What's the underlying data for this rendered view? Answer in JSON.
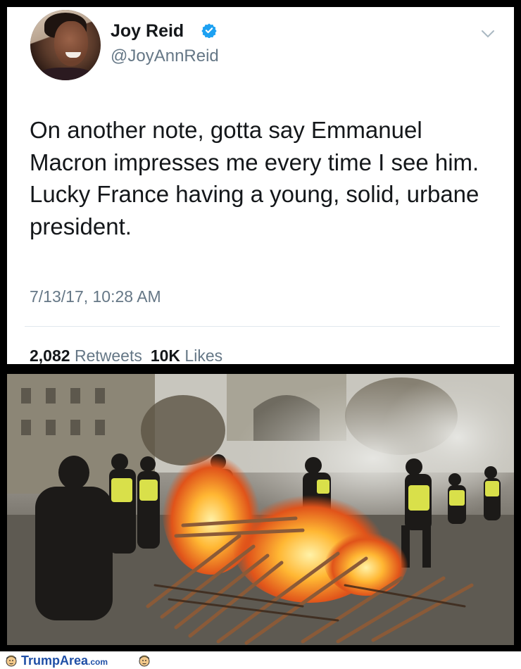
{
  "tweet": {
    "display_name": "Joy Reid",
    "handle": "@JoyAnnReid",
    "text": "On another note, gotta say Emmanuel Macron impresses me every time I see him. Lucky France having a young, solid, urbane president.",
    "timestamp": "7/13/17, 10:28 AM",
    "retweets_count": "2,082",
    "retweets_label": "Retweets",
    "likes_count": "10K",
    "likes_label": "Likes",
    "verified_color": "#1da1f2"
  },
  "footer": {
    "site_name": "TrumpArea",
    "site_tld": ".com",
    "brand_color": "#1f4fa6"
  }
}
